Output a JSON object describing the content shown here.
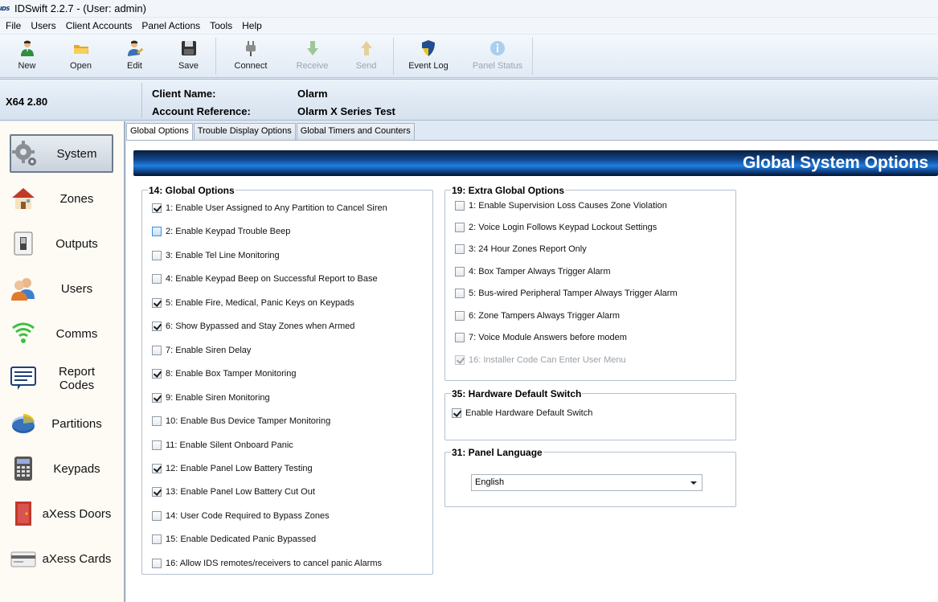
{
  "window": {
    "logo_text": "IDS",
    "title": "IDSwift 2.2.7 - (User: admin)"
  },
  "menu": [
    "File",
    "Users",
    "Client Accounts",
    "Panel Actions",
    "Tools",
    "Help"
  ],
  "toolbar": {
    "new": "New",
    "open": "Open",
    "edit": "Edit",
    "save": "Save",
    "connect": "Connect",
    "receive": "Receive",
    "send": "Send",
    "event_log": "Event Log",
    "panel_status": "Panel Status"
  },
  "info": {
    "panel_model": "X64 2.80",
    "client_name_label": "Client Name:",
    "client_name": "Olarm",
    "account_ref_label": "Account Reference:",
    "account_ref": "Olarm X Series Test"
  },
  "sidebar": [
    {
      "label": "System",
      "icon": "gear-icon",
      "active": true
    },
    {
      "label": "Zones",
      "icon": "house-icon"
    },
    {
      "label": "Outputs",
      "icon": "switch-icon"
    },
    {
      "label": "Users",
      "icon": "users-icon"
    },
    {
      "label": "Comms",
      "icon": "wifi-signal-icon"
    },
    {
      "label": "Report Codes",
      "icon": "report-document-icon"
    },
    {
      "label": "Partitions",
      "icon": "pie-chart-icon"
    },
    {
      "label": "Keypads",
      "icon": "keypad-icon"
    },
    {
      "label": "aXess Doors",
      "icon": "door-icon"
    },
    {
      "label": "aXess Cards",
      "icon": "access-card-icon"
    }
  ],
  "tabs": [
    "Global Options",
    "Trouble Display Options",
    "Global Timers and Counters"
  ],
  "banner_title": "Global System Options",
  "global_options": {
    "title": "14: Global Options",
    "items": [
      {
        "label": "1: Enable User Assigned to Any Partition to Cancel Siren",
        "checked": true
      },
      {
        "label": "2: Enable Keypad Trouble Beep",
        "checked": false
      },
      {
        "label": "3: Enable Tel Line Monitoring",
        "checked": false
      },
      {
        "label": "4: Enable Keypad Beep on Successful Report to Base",
        "checked": false
      },
      {
        "label": "5: Enable Fire, Medical, Panic Keys on Keypads",
        "checked": true
      },
      {
        "label": "6: Show Bypassed and Stay Zones when Armed",
        "checked": true
      },
      {
        "label": "7: Enable Siren Delay",
        "checked": false
      },
      {
        "label": "8: Enable Box Tamper Monitoring",
        "checked": true
      },
      {
        "label": "9: Enable Siren Monitoring",
        "checked": true
      },
      {
        "label": "10: Enable Bus Device Tamper Monitoring",
        "checked": false
      },
      {
        "label": "11: Enable Silent Onboard Panic",
        "checked": false
      },
      {
        "label": "12: Enable Panel Low Battery Testing",
        "checked": true
      },
      {
        "label": "13: Enable Panel Low Battery Cut Out",
        "checked": true
      },
      {
        "label": "14: User Code Required to Bypass Zones",
        "checked": false
      },
      {
        "label": "15: Enable Dedicated Panic Bypassed",
        "checked": false
      },
      {
        "label": "16: Allow IDS remotes/receivers to cancel panic Alarms",
        "checked": false
      }
    ]
  },
  "extra_options": {
    "title": "19: Extra Global Options",
    "items": [
      {
        "label": "1: Enable Supervision Loss Causes Zone Violation",
        "checked": false
      },
      {
        "label": "2: Voice Login Follows Keypad Lockout Settings",
        "checked": false
      },
      {
        "label": "3: 24 Hour Zones Report Only",
        "checked": false
      },
      {
        "label": "4: Box Tamper Always Trigger Alarm",
        "checked": false
      },
      {
        "label": "5: Bus-wired Peripheral Tamper Always Trigger Alarm",
        "checked": false
      },
      {
        "label": "6: Zone Tampers Always Trigger Alarm",
        "checked": false
      },
      {
        "label": "7: Voice Module Answers before modem",
        "checked": false
      },
      {
        "label": "16: Installer Code Can Enter User Menu",
        "checked": true,
        "disabled": true
      }
    ]
  },
  "hardware_default": {
    "title": "35: Hardware Default Switch",
    "label": "Enable Hardware Default Switch",
    "checked": true
  },
  "panel_language": {
    "title": "31: Panel Language",
    "selected": "English"
  }
}
